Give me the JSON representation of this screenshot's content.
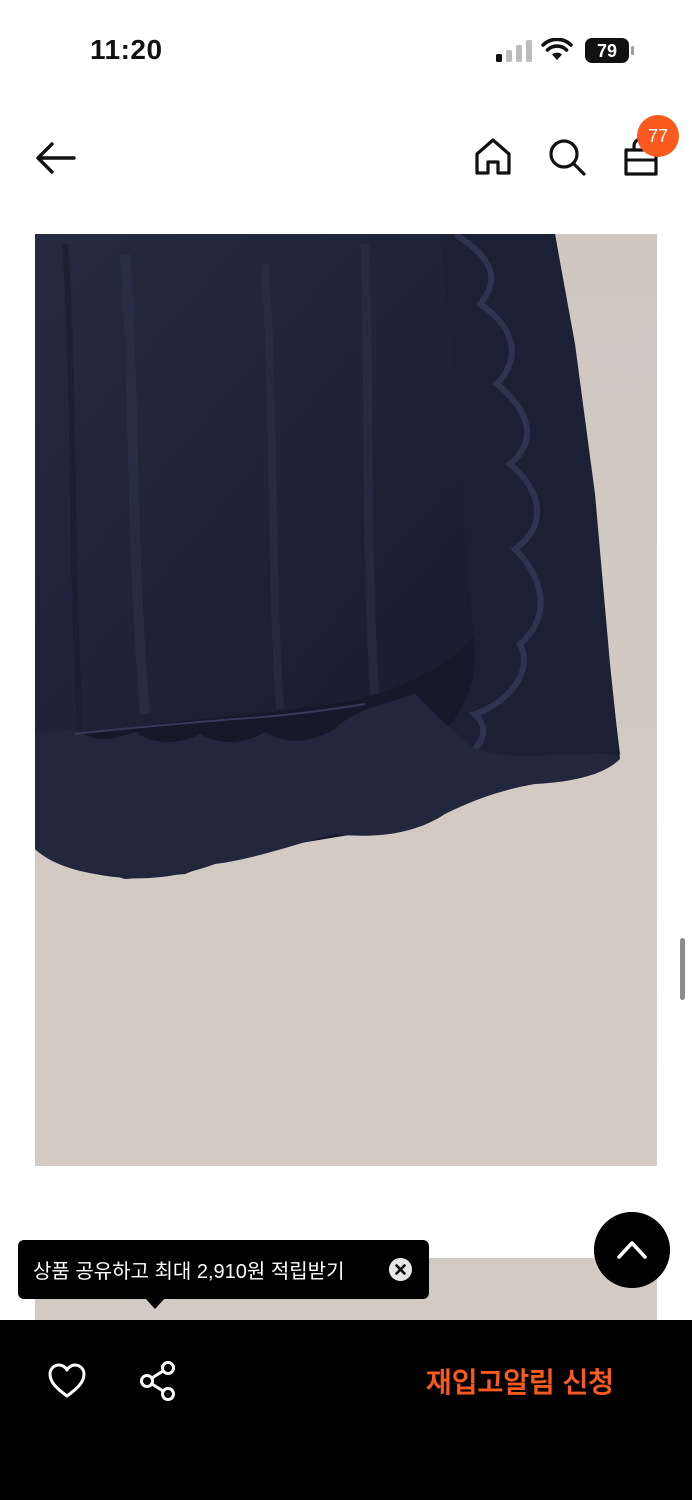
{
  "status_bar": {
    "time": "11:20",
    "battery_level": "79"
  },
  "header": {
    "back_icon": "arrow-left-icon",
    "home_icon": "home-icon",
    "search_icon": "search-icon",
    "cart_icon": "shopping-bag-icon",
    "cart_count": "77"
  },
  "product_images": [
    {
      "description_icon": "product-photo-navy-ruffle-skirt"
    },
    {
      "description_icon": "product-photo-next"
    }
  ],
  "tooltip": {
    "text": "상품 공유하고 최대 2,910원 적립받기",
    "close_icon": "close-circle-icon"
  },
  "bottom_bar": {
    "like_icon": "heart-icon",
    "share_icon": "share-icon",
    "restock_label": "재입고알림 신청"
  },
  "colors": {
    "accent": "#fa5a1e",
    "bar_bg": "#000000",
    "photo_bg": "#d3cbc4",
    "skirt": "#1e2238"
  }
}
